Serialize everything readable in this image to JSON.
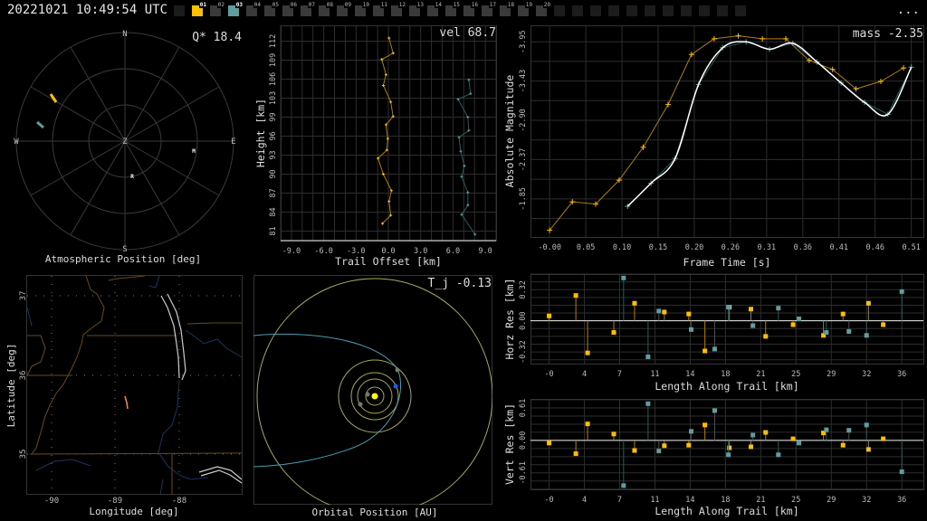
{
  "header": {
    "timestamp": "20221021 10:49:54 UTC",
    "more_label": "...",
    "tabs": [
      {
        "label": "01",
        "state": "orange"
      },
      {
        "label": "02",
        "state": "off"
      },
      {
        "label": "03",
        "state": "teal"
      },
      {
        "label": "04",
        "state": "off"
      },
      {
        "label": "05",
        "state": "off"
      },
      {
        "label": "06",
        "state": "off"
      },
      {
        "label": "07",
        "state": "off"
      },
      {
        "label": "08",
        "state": "off"
      },
      {
        "label": "09",
        "state": "off"
      },
      {
        "label": "10",
        "state": "off"
      },
      {
        "label": "11",
        "state": "off"
      },
      {
        "label": "12",
        "state": "off"
      },
      {
        "label": "13",
        "state": "off"
      },
      {
        "label": "14",
        "state": "off"
      },
      {
        "label": "15",
        "state": "off"
      },
      {
        "label": "16",
        "state": "off"
      },
      {
        "label": "17",
        "state": "off"
      },
      {
        "label": "18",
        "state": "off"
      },
      {
        "label": "19",
        "state": "off"
      },
      {
        "label": "20",
        "state": "off"
      }
    ]
  },
  "colors": {
    "orange": "#ffbf00",
    "orange_line": "#b07f00",
    "teal": "#5f9ea0",
    "teal_line": "#2f5a5a",
    "grid": "#2e2e2e",
    "text": "#d8d8d8",
    "fit": "#ffffff",
    "orbit": "#a8a85a",
    "comet": "#4a9cb0"
  },
  "polar": {
    "title": "Atmospheric Position [deg]",
    "stat": "Q* 18.4",
    "compass": {
      "n": "N",
      "s": "S",
      "e": "E",
      "w": "W",
      "z": "Z"
    },
    "stations": [
      {
        "label": "M"
      },
      {
        "label": "R"
      }
    ]
  },
  "chart_data": [
    {
      "id": "trail",
      "type": "scatter",
      "stat": "vel 68.7",
      "xlabel": "Trail Offset [km]",
      "ylabel": "Height [km]",
      "xlim": [
        -10,
        10
      ],
      "ylim": [
        79.5,
        113.5
      ],
      "xticks": [
        "-9.0",
        "-6.0",
        "-3.0",
        "0.0",
        "3.0",
        "6.0",
        "9.0"
      ],
      "xtick_values": [
        -9,
        -6,
        -3,
        0,
        3,
        6,
        9
      ],
      "yticks": [
        "81",
        "84",
        "87",
        "90",
        "93",
        "96",
        "99",
        "103",
        "106",
        "109",
        "112"
      ],
      "ytick_values": [
        81,
        84,
        87,
        90,
        93,
        96,
        99,
        102,
        105,
        108,
        111
      ],
      "series": [
        {
          "name": "station-01",
          "color": "orange",
          "points": [
            [
              0.06,
              111.5
            ],
            [
              0.44,
              109.1
            ],
            [
              -0.61,
              108.1
            ],
            [
              -0.22,
              105.7
            ],
            [
              -0.47,
              104.0
            ],
            [
              0.22,
              101.4
            ],
            [
              0.44,
              99.1
            ],
            [
              -0.22,
              97.8
            ],
            [
              -0.06,
              95.6
            ],
            [
              -0.14,
              93.8
            ],
            [
              -0.96,
              92.5
            ],
            [
              -0.47,
              90.0
            ],
            [
              0.28,
              87.4
            ],
            [
              0.06,
              85.7
            ],
            [
              0.22,
              83.5
            ],
            [
              -0.55,
              82.2
            ]
          ]
        },
        {
          "name": "station-03",
          "color": "teal",
          "points": [
            [
              7.47,
              104.9
            ],
            [
              7.63,
              102.7
            ],
            [
              6.47,
              101.8
            ],
            [
              7.38,
              99.0
            ],
            [
              7.47,
              96.9
            ],
            [
              6.56,
              95.8
            ],
            [
              6.72,
              93.6
            ],
            [
              7.05,
              91.3
            ],
            [
              6.8,
              89.6
            ],
            [
              7.38,
              87.1
            ],
            [
              7.38,
              85.1
            ],
            [
              6.8,
              83.6
            ],
            [
              8.04,
              80.5
            ]
          ]
        }
      ]
    },
    {
      "id": "magnitude",
      "type": "line",
      "stat": "mass -2.35",
      "xlabel": "Frame Time [s]",
      "ylabel": "Absolute Magnitude",
      "xlim": [
        -0.027,
        0.527
      ],
      "ylim": [
        -4.17,
        -1.34
      ],
      "xticks": [
        "-0.00",
        "0.05",
        "0.10",
        "0.15",
        "0.20",
        "0.26",
        "0.31",
        "0.36",
        "0.41",
        "0.46",
        "0.51"
      ],
      "xtick_values": [
        0,
        0.051,
        0.102,
        0.153,
        0.204,
        0.255,
        0.306,
        0.357,
        0.408,
        0.459,
        0.51
      ],
      "yticks": [
        "-3.95",
        "-3.43",
        "-2.90",
        "-2.37",
        "-1.85"
      ],
      "ytick_values": [
        -3.95,
        -3.425,
        -2.9,
        -2.375,
        -1.85
      ],
      "series": [
        {
          "name": "station-01",
          "color": "orange",
          "points": [
            [
              0,
              -1.43
            ],
            [
              0.032,
              -1.81
            ],
            [
              0.065,
              -1.78
            ],
            [
              0.098,
              -2.1
            ],
            [
              0.132,
              -2.54
            ],
            [
              0.167,
              -3.11
            ],
            [
              0.2,
              -3.78
            ],
            [
              0.232,
              -3.99
            ],
            [
              0.266,
              -4.03
            ],
            [
              0.3,
              -3.99
            ],
            [
              0.333,
              -3.99
            ],
            [
              0.366,
              -3.7
            ],
            [
              0.399,
              -3.58
            ],
            [
              0.432,
              -3.32
            ],
            [
              0.467,
              -3.42
            ],
            [
              0.499,
              -3.6
            ]
          ]
        },
        {
          "name": "station-03",
          "color": "teal",
          "points": [
            [
              0.11,
              -1.75
            ],
            [
              0.143,
              -2.06
            ],
            [
              0.177,
              -2.39
            ],
            [
              0.21,
              -3.38
            ],
            [
              0.244,
              -3.87
            ],
            [
              0.277,
              -3.95
            ],
            [
              0.31,
              -3.85
            ],
            [
              0.343,
              -3.93
            ],
            [
              0.377,
              -3.68
            ],
            [
              0.411,
              -3.4
            ],
            [
              0.444,
              -3.14
            ],
            [
              0.477,
              -2.98
            ],
            [
              0.51,
              -3.61
            ]
          ]
        }
      ],
      "fit": {
        "name": "fit",
        "color": "fit"
      }
    },
    {
      "id": "horz_res",
      "type": "scatter",
      "xlabel": "Length Along Trail [km]",
      "ylabel": "Horz Res [km]",
      "xlim": [
        -1.9,
        38.2
      ],
      "ylim": [
        -0.44,
        0.48
      ],
      "xticks": [
        "-0",
        "4",
        "7",
        "11",
        "14",
        "18",
        "21",
        "25",
        "29",
        "32",
        "36"
      ],
      "xtick_values": [
        0,
        3.6,
        7.2,
        10.8,
        14.4,
        18,
        21.6,
        25.2,
        28.8,
        32.4,
        36
      ],
      "yticks": [
        "-0.32",
        "0.00",
        "0.32"
      ],
      "ytick_values": [
        -0.32,
        0,
        0.32
      ],
      "series": [
        {
          "name": "station-01",
          "color": "orange",
          "points": [
            [
              0,
              0.05
            ],
            [
              2.73,
              0.26
            ],
            [
              3.93,
              -0.33
            ],
            [
              6.6,
              -0.12
            ],
            [
              8.72,
              0.18
            ],
            [
              11.76,
              0.09
            ],
            [
              14.25,
              0.07
            ],
            [
              15.9,
              -0.31
            ],
            [
              18.4,
              0.14
            ],
            [
              20.6,
              0.12
            ],
            [
              22.1,
              -0.16
            ],
            [
              24.9,
              -0.04
            ],
            [
              28.0,
              -0.15
            ],
            [
              30.0,
              0.07
            ],
            [
              32.6,
              0.18
            ],
            [
              34.1,
              -0.04
            ]
          ]
        },
        {
          "name": "station-03",
          "color": "teal",
          "points": [
            [
              7.6,
              0.44
            ],
            [
              10.1,
              -0.37
            ],
            [
              11.2,
              0.1
            ],
            [
              14.5,
              -0.09
            ],
            [
              16.9,
              -0.29
            ],
            [
              18.3,
              0.14
            ],
            [
              20.8,
              -0.05
            ],
            [
              23.4,
              0.13
            ],
            [
              25.5,
              0.02
            ],
            [
              28.3,
              -0.12
            ],
            [
              30.6,
              -0.11
            ],
            [
              32.4,
              -0.15
            ],
            [
              36.0,
              0.3
            ]
          ]
        }
      ]
    },
    {
      "id": "vert_res",
      "type": "scatter",
      "xlabel": "Length Along Trail [km]",
      "ylabel": "Vert Res [km]",
      "xlim": [
        -1.9,
        38.2
      ],
      "ylim": [
        -0.92,
        0.78
      ],
      "xticks": [
        "-0",
        "4",
        "7",
        "11",
        "14",
        "18",
        "21",
        "25",
        "29",
        "32",
        "36"
      ],
      "xtick_values": [
        0,
        3.6,
        7.2,
        10.8,
        14.4,
        18,
        21.6,
        25.2,
        28.8,
        32.4,
        36
      ],
      "yticks": [
        "-0.61",
        "0.00",
        "0.61"
      ],
      "ytick_values": [
        -0.61,
        0,
        0.61
      ],
      "series": [
        {
          "name": "station-01",
          "color": "orange",
          "points": [
            [
              0,
              -0.05
            ],
            [
              2.73,
              -0.25
            ],
            [
              3.93,
              0.31
            ],
            [
              6.6,
              0.12
            ],
            [
              8.72,
              -0.19
            ],
            [
              11.76,
              -0.1
            ],
            [
              14.25,
              -0.09
            ],
            [
              15.9,
              0.29
            ],
            [
              18.4,
              -0.14
            ],
            [
              20.6,
              -0.12
            ],
            [
              22.1,
              0.15
            ],
            [
              24.9,
              0.03
            ],
            [
              28.0,
              0.14
            ],
            [
              30.0,
              -0.09
            ],
            [
              32.6,
              -0.17
            ],
            [
              34.1,
              0.03
            ]
          ]
        },
        {
          "name": "station-03",
          "color": "teal",
          "points": [
            [
              7.6,
              -0.85
            ],
            [
              10.1,
              0.69
            ],
            [
              11.2,
              -0.2
            ],
            [
              14.5,
              0.17
            ],
            [
              16.9,
              0.56
            ],
            [
              18.3,
              -0.27
            ],
            [
              20.8,
              0.1
            ],
            [
              23.4,
              -0.27
            ],
            [
              25.5,
              -0.05
            ],
            [
              28.3,
              0.2
            ],
            [
              30.6,
              0.19
            ],
            [
              32.4,
              0.29
            ],
            [
              36.0,
              -0.59
            ]
          ]
        }
      ]
    }
  ],
  "map": {
    "xlabel": "Longitude [deg]",
    "ylabel": "Latitude [deg]",
    "xticks": [
      "-90",
      "-89",
      "-88"
    ],
    "yticks": [
      "37",
      "36",
      "35"
    ]
  },
  "orbit": {
    "xlabel": "Orbital Position [AU]",
    "stat": "T_j -0.13"
  }
}
